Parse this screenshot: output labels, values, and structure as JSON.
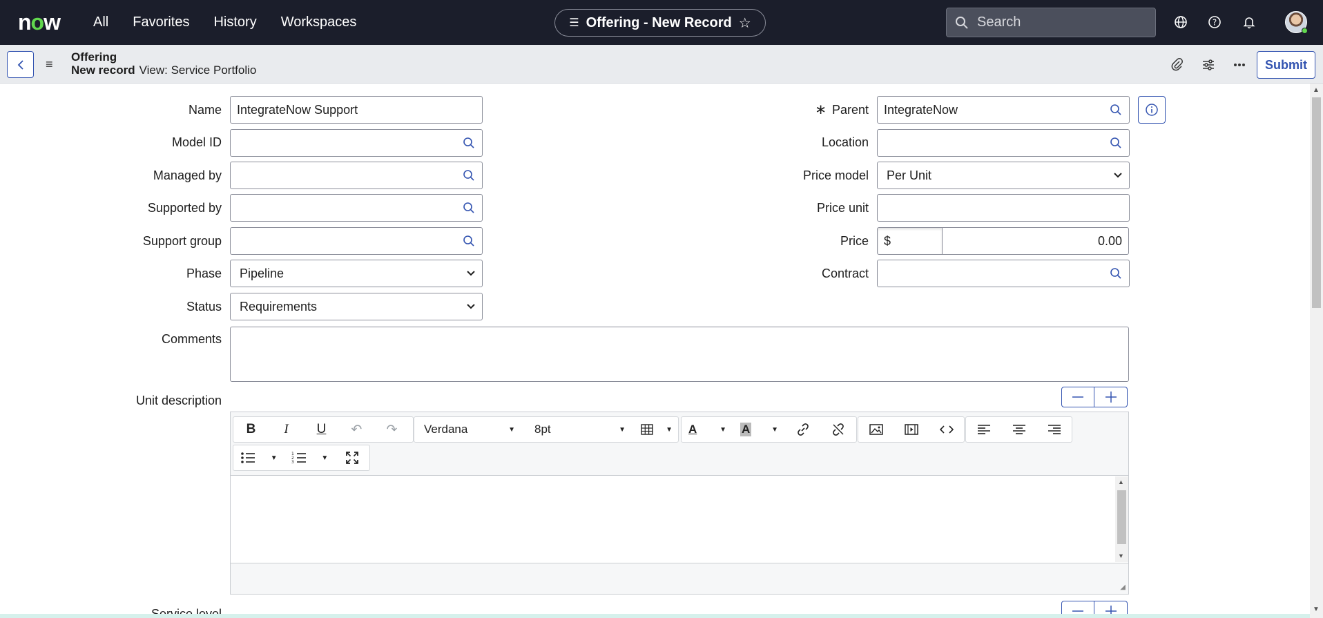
{
  "nav": {
    "logo_pre": "n",
    "logo_o": "o",
    "logo_post": "w",
    "links": [
      "All",
      "Favorites",
      "History",
      "Workspaces"
    ],
    "record_title": "Offering - New Record",
    "search_placeholder": "Search",
    "icons": [
      "globe-icon",
      "help-icon",
      "bell-icon",
      "avatar"
    ]
  },
  "header": {
    "table": "Offering",
    "record_state": "New record",
    "view": "View: Service Portfolio",
    "submit_label": "Submit",
    "icons": [
      "paperclip-icon",
      "sliders-icon",
      "more-icon"
    ]
  },
  "form": {
    "left": {
      "name_label": "Name",
      "name_value": "IntegrateNow Support",
      "model_id_label": "Model ID",
      "model_id_value": "",
      "managed_by_label": "Managed by",
      "managed_by_value": "",
      "supported_by_label": "Supported by",
      "supported_by_value": "",
      "support_group_label": "Support group",
      "support_group_value": "",
      "phase_label": "Phase",
      "phase_value": "Pipeline",
      "status_label": "Status",
      "status_value": "Requirements"
    },
    "right": {
      "parent_label": "Parent",
      "parent_required": "∗",
      "parent_value": "IntegrateNow",
      "location_label": "Location",
      "location_value": "",
      "price_model_label": "Price model",
      "price_model_value": "Per Unit",
      "price_unit_label": "Price unit",
      "price_unit_value": "",
      "price_label": "Price",
      "price_currency": "$",
      "price_value": "0.00",
      "contract_label": "Contract",
      "contract_value": ""
    },
    "comments_label": "Comments",
    "unit_description_label": "Unit description",
    "service_level_label": "Service level requirement"
  },
  "editor": {
    "font_family": "Verdana",
    "font_size": "8pt"
  },
  "colors": {
    "nav_bg": "#1b1e2b",
    "accent": "#3253b0",
    "logo_green": "#62d84e"
  }
}
